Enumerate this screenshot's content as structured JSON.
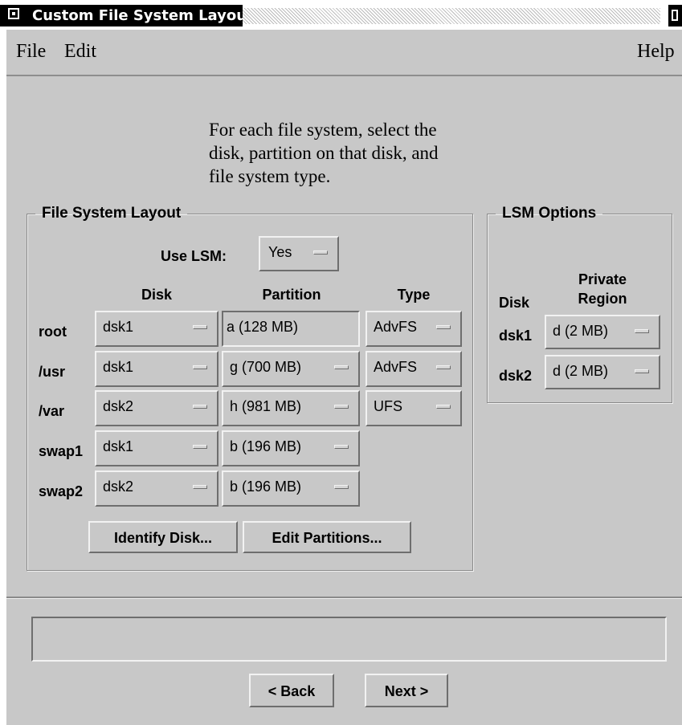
{
  "window": {
    "title": "Custom File System Layout"
  },
  "menu": {
    "file": "File",
    "edit": "Edit",
    "help": "Help"
  },
  "instructions": "For each file system, select the\ndisk, partition on that disk, and\nfile system type.",
  "fs_layout": {
    "legend": "File System Layout",
    "use_lsm_label": "Use LSM:",
    "use_lsm_value": "Yes",
    "headers": {
      "disk": "Disk",
      "partition": "Partition",
      "type": "Type"
    },
    "rows": [
      {
        "name": "root",
        "disk": "dsk1",
        "partition": "a (128 MB)",
        "partition_editable": false,
        "type": "AdvFS"
      },
      {
        "name": "/usr",
        "disk": "dsk1",
        "partition": "g (700 MB)",
        "partition_editable": true,
        "type": "AdvFS"
      },
      {
        "name": "/var",
        "disk": "dsk2",
        "partition": "h (981 MB)",
        "partition_editable": true,
        "type": "UFS"
      },
      {
        "name": "swap1",
        "disk": "dsk1",
        "partition": "b (196 MB)",
        "partition_editable": true,
        "type": null
      },
      {
        "name": "swap2",
        "disk": "dsk2",
        "partition": "b (196 MB)",
        "partition_editable": true,
        "type": null
      }
    ],
    "identify_disk_button": "Identify Disk...",
    "edit_partitions_button": "Edit Partitions..."
  },
  "lsm_options": {
    "legend": "LSM Options",
    "header_disk": "Disk",
    "header_private_line1": "Private",
    "header_private_line2": "Region",
    "rows": [
      {
        "disk": "dsk1",
        "region": "d (2 MB)"
      },
      {
        "disk": "dsk2",
        "region": "d (2 MB)"
      }
    ]
  },
  "status_text": "",
  "nav": {
    "back": "< Back",
    "next": "Next >"
  },
  "colors": {
    "window_bg": "#c8c8c8",
    "title_bg": "#000000"
  }
}
